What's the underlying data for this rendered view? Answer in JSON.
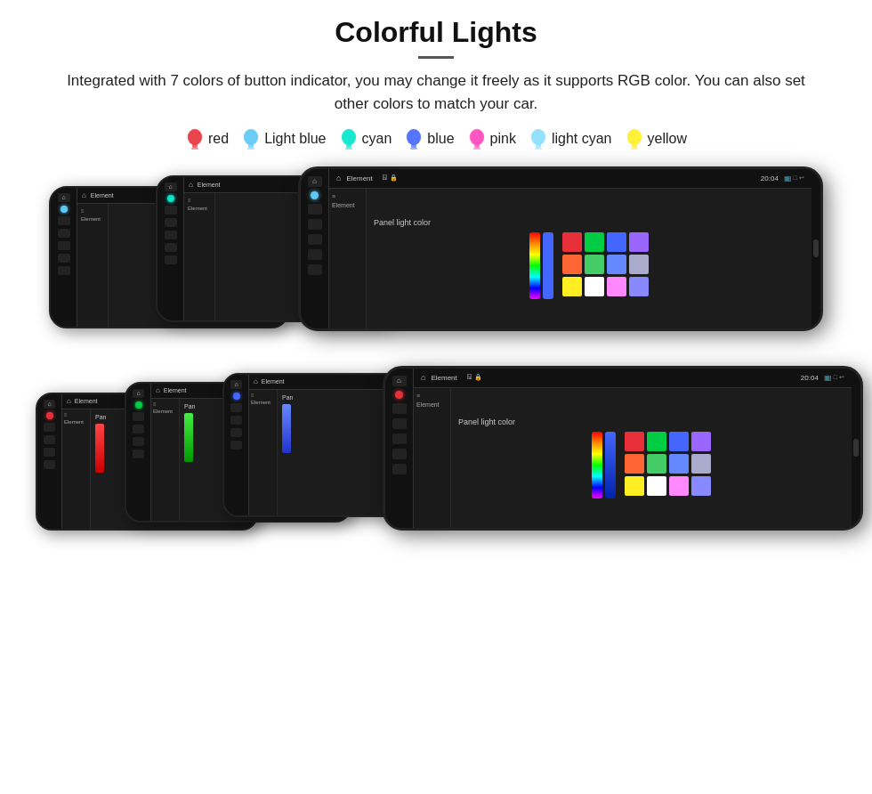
{
  "title": "Colorful Lights",
  "description": "Integrated with 7 colors of button indicator, you may change it freely as it supports RGB color. You can also set other colors to match your car.",
  "colors": [
    {
      "name": "red",
      "hex": "#e8303a",
      "bulbColor": "#e8303a",
      "glowColor": "#ff6666"
    },
    {
      "name": "Light blue",
      "hex": "#5bc8f5",
      "bulbColor": "#5bc8f5",
      "glowColor": "#aaddff"
    },
    {
      "name": "cyan",
      "hex": "#00e5cc",
      "bulbColor": "#00e5cc",
      "glowColor": "#66ffee"
    },
    {
      "name": "blue",
      "hex": "#4466ff",
      "bulbColor": "#4466ff",
      "glowColor": "#8899ff"
    },
    {
      "name": "pink",
      "hex": "#ff44bb",
      "bulbColor": "#ff44bb",
      "glowColor": "#ff88dd"
    },
    {
      "name": "light cyan",
      "hex": "#88ddff",
      "bulbColor": "#88ddff",
      "glowColor": "#bbeeee"
    },
    {
      "name": "yellow",
      "hex": "#ffee22",
      "bulbColor": "#ffee22",
      "glowColor": "#ffffaa"
    }
  ],
  "colorPanelTitle": "Panel light color",
  "colorBars": [
    {
      "color": "#e8303a",
      "height": 60
    },
    {
      "color": "#4466ff",
      "height": 60
    }
  ],
  "colorGrid": [
    "#e8303a",
    "#00cc44",
    "#4466ff",
    "#9966ff",
    "#ff6633",
    "#44cc66",
    "#6688ff",
    "#aaaacc",
    "#ffee22",
    "#ffffff",
    "#ff88ff",
    "#8888ff"
  ],
  "topDevices": [
    {
      "indicatorColor": "#5bc8f5",
      "content": "menu"
    },
    {
      "indicatorColor": "#00e5cc",
      "content": "menu"
    },
    {
      "indicatorColor": "#5bc8f5",
      "content": "colorPanel"
    }
  ],
  "bottomDevices": [
    {
      "indicatorColor": "#e8303a",
      "content": "redBar"
    },
    {
      "indicatorColor": "#00cc44",
      "content": "greenBar"
    },
    {
      "indicatorColor": "#4466ff",
      "content": "blueBar"
    },
    {
      "indicatorColor": "#e8303a",
      "content": "colorPanel"
    }
  ]
}
